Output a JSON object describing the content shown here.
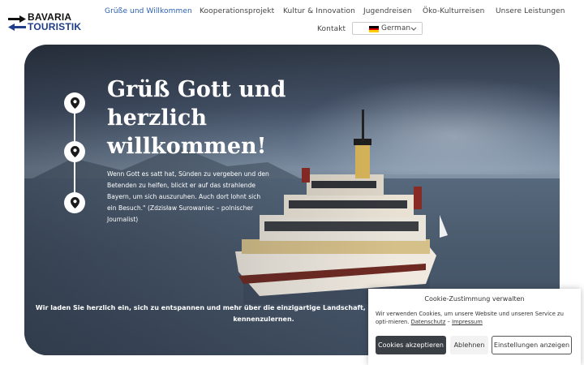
{
  "brand": {
    "line1": "BAVARIA",
    "line2": "TOURISTIK"
  },
  "nav": {
    "items": [
      {
        "label": "Grüße und Willkommen",
        "active": true
      },
      {
        "label": "Kooperationsprojekt",
        "active": false
      },
      {
        "label": "Kultur & Innovation",
        "active": false
      },
      {
        "label": "Jugendreisen",
        "active": false
      },
      {
        "label": "Öko-Kulturreisen",
        "active": false
      },
      {
        "label": "Unsere Leistungen",
        "active": false
      },
      {
        "label": "Kontakt",
        "active": false
      }
    ],
    "language": {
      "selected": "German",
      "flag_icon": "german-flag-icon"
    }
  },
  "hero": {
    "title": "Grüß Gott und herzlich willkommen!",
    "quote": "Wenn Gott es satt hat, Sünden zu vergeben und den Betenden zu helfen, blickt er auf das strahlende Bayern, um sich auszuruhen. Auch dort lohnt sich ein Besuch.\" (Zdzisław Surowaniec – polnischer Journalist)",
    "invite": "Wir laden Sie herzlich ein, sich zu entspannen und mehr über die einzigartige Landschaft, das Leben und die Kultur Bayerns kennenzulernen.",
    "pin_icon": "location-pin-icon"
  },
  "cookie": {
    "title": "Cookie-Zustimmung verwalten",
    "text_before": "Wir verwenden Cookies, um unsere Website und unseren Service zu opti-mieren.",
    "link_privacy": "Datenschutz",
    "separator": "–",
    "link_imprint": "Impressum",
    "accept_label": "Cookies akzeptieren",
    "decline_label": "Ablehnen",
    "settings_label": "Einstellungen anzeigen"
  },
  "colors": {
    "nav_active": "#2a5eb0",
    "brand_blue": "#1f3d8a",
    "accept_button": "#3a3f45"
  }
}
